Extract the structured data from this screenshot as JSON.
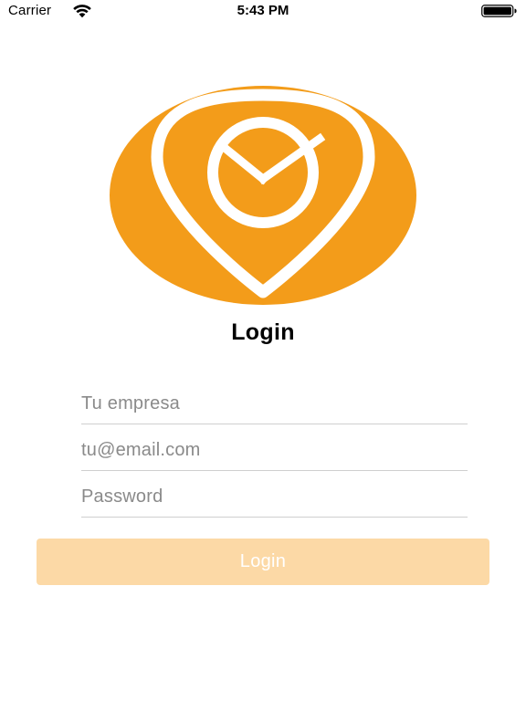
{
  "status_bar": {
    "carrier": "Carrier",
    "time": "5:43 PM",
    "icons": [
      "wifi-icon",
      "battery-icon"
    ]
  },
  "logo": {
    "icon": "location-pin-clock-icon",
    "background_color": "#f39c1a",
    "foreground_color": "#ffffff"
  },
  "title": "Login",
  "form": {
    "company_placeholder": "Tu empresa",
    "company_value": "",
    "email_placeholder": "tu@email.com",
    "email_value": "",
    "password_placeholder": "Password",
    "password_value": ""
  },
  "login_button": {
    "label": "Login",
    "background_color": "#fcd9a6",
    "text_color": "#ffffff"
  }
}
